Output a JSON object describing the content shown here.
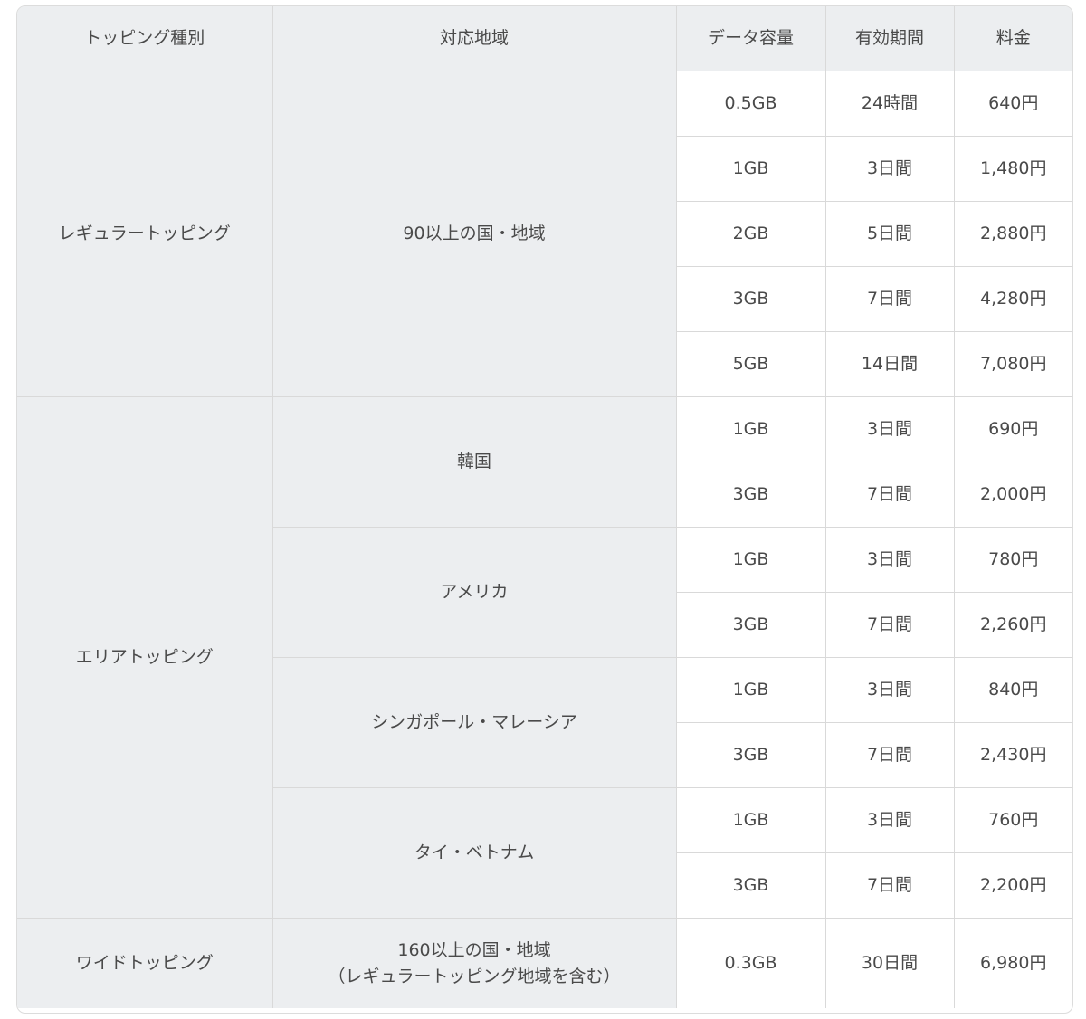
{
  "table": {
    "headers": [
      "トッピング種別",
      "対応地域",
      "データ容量",
      "有効期間",
      "料金"
    ],
    "groups": [
      {
        "type": "レギュラートッピング",
        "regions": [
          {
            "region": [
              "90以上の国・地域"
            ],
            "rows": [
              {
                "data": "0.5GB",
                "period": "24時間",
                "price": "640円"
              },
              {
                "data": "1GB",
                "period": "3日間",
                "price": "1,480円"
              },
              {
                "data": "2GB",
                "period": "5日間",
                "price": "2,880円"
              },
              {
                "data": "3GB",
                "period": "7日間",
                "price": "4,280円"
              },
              {
                "data": "5GB",
                "period": "14日間",
                "price": "7,080円"
              }
            ]
          }
        ]
      },
      {
        "type": "エリアトッピング",
        "regions": [
          {
            "region": [
              "韓国"
            ],
            "rows": [
              {
                "data": "1GB",
                "period": "3日間",
                "price": "690円"
              },
              {
                "data": "3GB",
                "period": "7日間",
                "price": "2,000円"
              }
            ]
          },
          {
            "region": [
              "アメリカ"
            ],
            "rows": [
              {
                "data": "1GB",
                "period": "3日間",
                "price": "780円"
              },
              {
                "data": "3GB",
                "period": "7日間",
                "price": "2,260円"
              }
            ]
          },
          {
            "region": [
              "シンガポール・マレーシア"
            ],
            "rows": [
              {
                "data": "1GB",
                "period": "3日間",
                "price": "840円"
              },
              {
                "data": "3GB",
                "period": "7日間",
                "price": "2,430円"
              }
            ]
          },
          {
            "region": [
              "タイ・ベトナム"
            ],
            "rows": [
              {
                "data": "1GB",
                "period": "3日間",
                "price": "760円"
              },
              {
                "data": "3GB",
                "period": "7日間",
                "price": "2,200円"
              }
            ]
          }
        ]
      },
      {
        "type": "ワイドトッピング",
        "regions": [
          {
            "region": [
              "160以上の国・地域",
              "（レギュラートッピング地域を含む）"
            ],
            "rows": [
              {
                "data": "0.3GB",
                "period": "30日間",
                "price": "6,980円"
              }
            ]
          }
        ]
      }
    ]
  }
}
